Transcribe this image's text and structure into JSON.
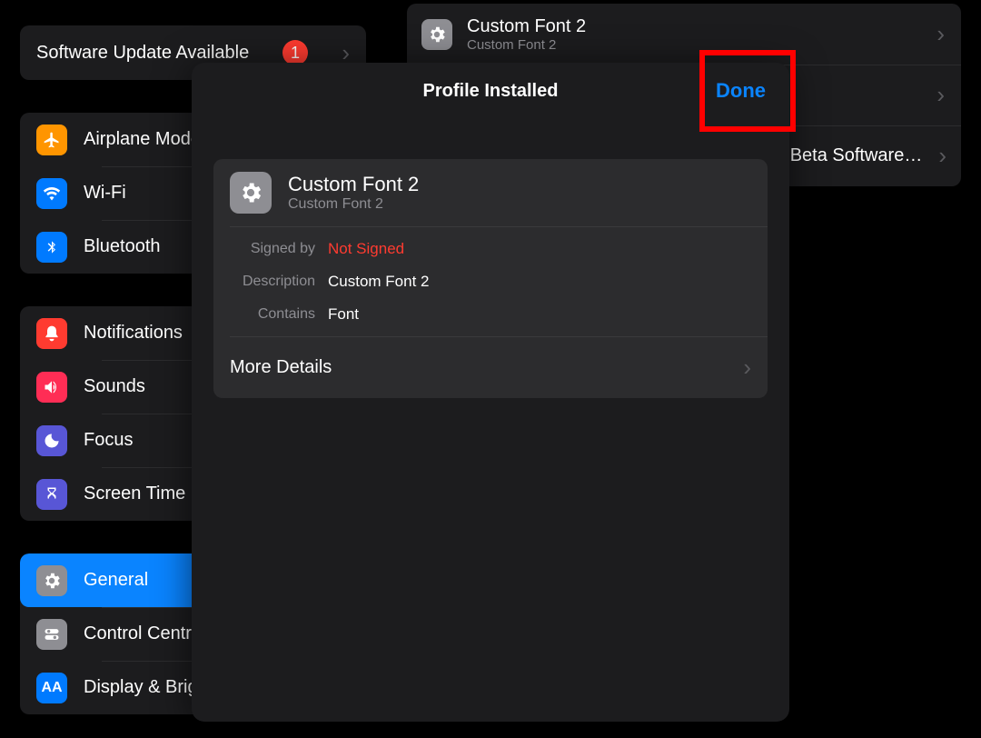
{
  "sidebar": {
    "update_label": "Software Update Available",
    "update_badge": "1",
    "section1": [
      {
        "label": "Airplane Mode"
      },
      {
        "label": "Wi-Fi"
      },
      {
        "label": "Bluetooth"
      }
    ],
    "section2": [
      {
        "label": "Notifications"
      },
      {
        "label": "Sounds"
      },
      {
        "label": "Focus"
      },
      {
        "label": "Screen Time"
      }
    ],
    "section3": [
      {
        "label": "General"
      },
      {
        "label": "Control Centre"
      },
      {
        "label": "Display & Brightness"
      }
    ]
  },
  "content": {
    "profile_title": "Custom Font 2",
    "profile_sub": "Custom Font 2",
    "beta_label": "Beta Software…"
  },
  "sheet": {
    "header_title": "Profile Installed",
    "done": "Done",
    "card_title": "Custom Font 2",
    "card_sub": "Custom Font 2",
    "signed_by_label": "Signed by",
    "signed_by_value": "Not Signed",
    "description_label": "Description",
    "description_value": "Custom Font 2",
    "contains_label": "Contains",
    "contains_value": "Font",
    "more_details": "More Details"
  }
}
